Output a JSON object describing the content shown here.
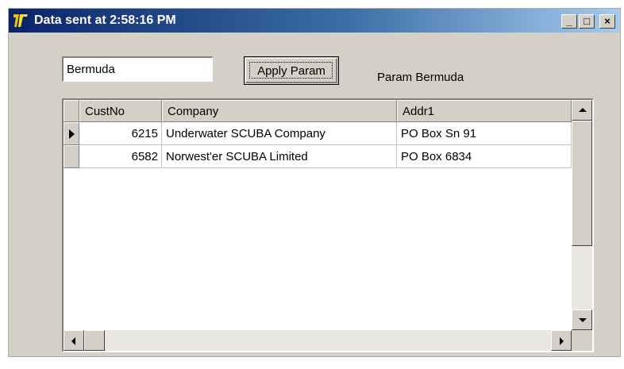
{
  "window": {
    "title": "Data sent at 2:58:16 PM",
    "minimize_label": "_",
    "maximize_label": "□",
    "close_label": "×"
  },
  "param": {
    "input_value": "Bermuda",
    "apply_label": "Apply Param",
    "status_label": "Param Bermuda"
  },
  "grid": {
    "columns": [
      "CustNo",
      "Company",
      "Addr1"
    ],
    "rows": [
      {
        "custno": "6215",
        "company": "Underwater SCUBA Company",
        "addr1": "PO Box Sn 91"
      },
      {
        "custno": "6582",
        "company": "Norwest'er SCUBA Limited",
        "addr1": "PO Box 6834"
      }
    ],
    "current_row": 0
  },
  "colors": {
    "titlebar_start": "#0a246a",
    "titlebar_end": "#a6caf0",
    "face": "#d4d0c8"
  }
}
